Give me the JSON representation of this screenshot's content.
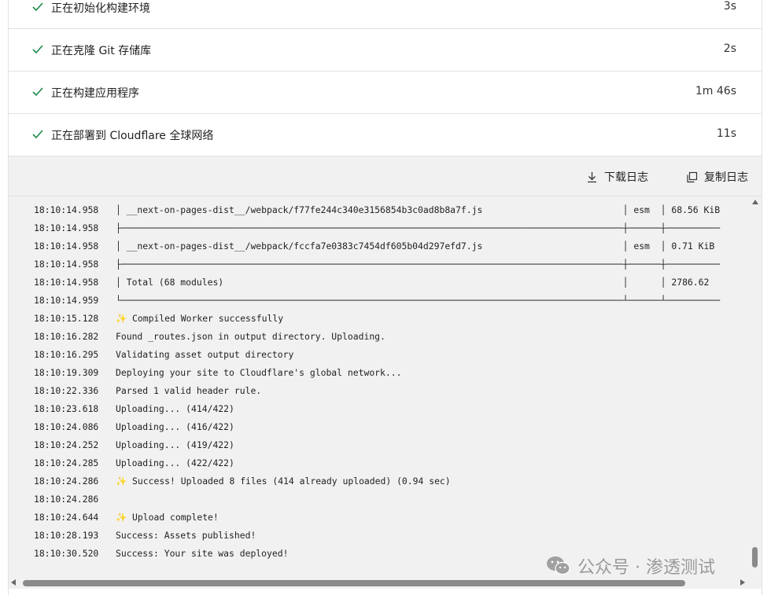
{
  "steps": [
    {
      "label": "正在初始化构建环境",
      "duration": "3s"
    },
    {
      "label": "正在克隆 Git 存储库",
      "duration": "2s"
    },
    {
      "label": "正在构建应用程序",
      "duration": "1m 46s"
    },
    {
      "label": "正在部署到 Cloudflare 全球网络",
      "duration": "11s"
    }
  ],
  "toolbar": {
    "download_label": "下载日志",
    "copy_label": "复制日志"
  },
  "log": [
    {
      "ts": "18:10:14.958",
      "text": "│ __next-on-pages-dist__/webpack/f77fe244c340e3156854b3c0ad8b8a7f.js                          │ esm  │ 68.56 KiB"
    },
    {
      "ts": "18:10:14.958",
      "text": "├─────────────────────────────────────────────────────────────────────────────────────────────┼──────┼──────────"
    },
    {
      "ts": "18:10:14.958",
      "text": "│ __next-on-pages-dist__/webpack/fccfa7e0383c7454df605b04d297efd7.js                          │ esm  │ 0.71 KiB"
    },
    {
      "ts": "18:10:14.958",
      "text": "├─────────────────────────────────────────────────────────────────────────────────────────────┼──────┼──────────"
    },
    {
      "ts": "18:10:14.958",
      "text": "│ Total (68 modules)                                                                          │      │ 2786.62"
    },
    {
      "ts": "18:10:14.959",
      "text": "└─────────────────────────────────────────────────────────────────────────────────────────────┴──────┴──────────"
    },
    {
      "ts": "18:10:15.128",
      "text": "✨ Compiled Worker successfully"
    },
    {
      "ts": "18:10:16.282",
      "text": "Found _routes.json in output directory. Uploading."
    },
    {
      "ts": "18:10:16.295",
      "text": "Validating asset output directory"
    },
    {
      "ts": "18:10:19.309",
      "text": "Deploying your site to Cloudflare's global network..."
    },
    {
      "ts": "18:10:22.336",
      "text": "Parsed 1 valid header rule."
    },
    {
      "ts": "18:10:23.618",
      "text": "Uploading... (414/422)"
    },
    {
      "ts": "18:10:24.086",
      "text": "Uploading... (416/422)"
    },
    {
      "ts": "18:10:24.252",
      "text": "Uploading... (419/422)"
    },
    {
      "ts": "18:10:24.285",
      "text": "Uploading... (422/422)"
    },
    {
      "ts": "18:10:24.286",
      "text": "✨ Success! Uploaded 8 files (414 already uploaded) (0.94 sec)"
    },
    {
      "ts": "18:10:24.286",
      "text": ""
    },
    {
      "ts": "18:10:24.644",
      "text": "✨ Upload complete!"
    },
    {
      "ts": "18:10:28.193",
      "text": "Success: Assets published!"
    },
    {
      "ts": "18:10:30.520",
      "text": "Success: Your site was deployed!"
    }
  ],
  "watermark": {
    "text": "公众号 · 渗透测试"
  },
  "colors": {
    "check": "#1a8a4a",
    "log_bg": "#f1f1f1",
    "sparkle": "#f0a040"
  }
}
